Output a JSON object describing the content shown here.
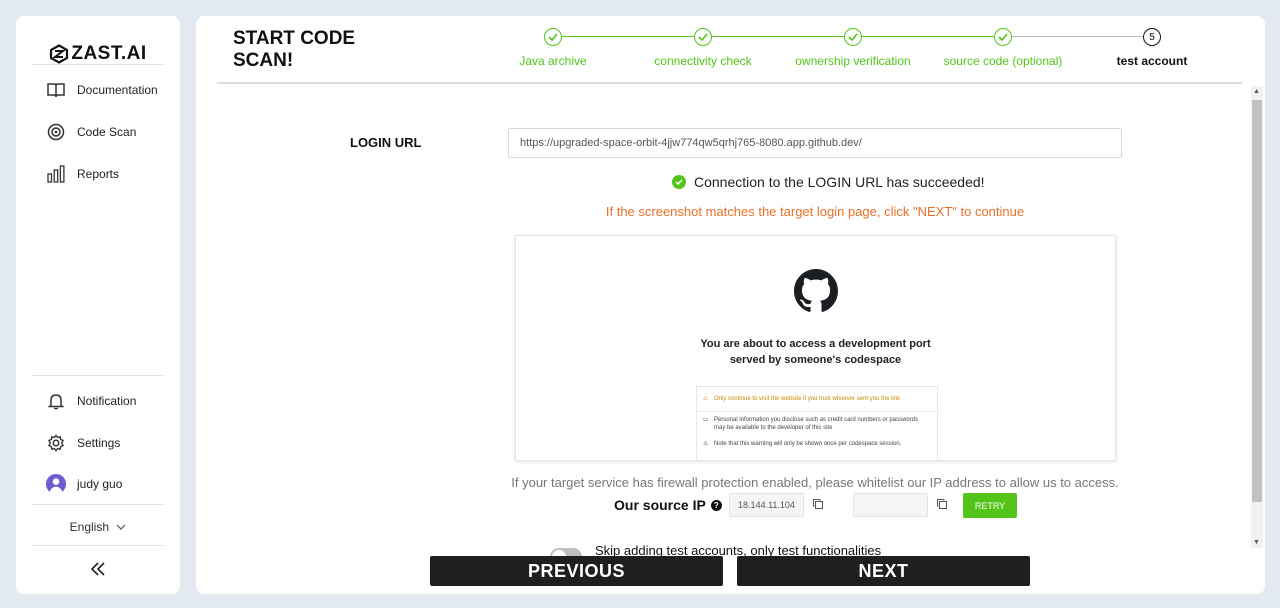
{
  "brand": {
    "name": "ZAST.AI"
  },
  "sidebar": {
    "items": [
      {
        "label": "Documentation",
        "icon": "book-icon"
      },
      {
        "label": "Code Scan",
        "icon": "scan-icon"
      },
      {
        "label": "Reports",
        "icon": "bar-chart-icon"
      }
    ],
    "bottom_items": [
      {
        "label": "Notification",
        "icon": "bell-icon"
      },
      {
        "label": "Settings",
        "icon": "gear-icon"
      },
      {
        "label": "judy guo",
        "icon": "avatar"
      }
    ],
    "language": "English"
  },
  "header": {
    "title": "START CODE SCAN!",
    "steps": [
      {
        "label": "Java archive",
        "status": "done"
      },
      {
        "label": "connectivity check",
        "status": "done"
      },
      {
        "label": "ownership verification",
        "status": "done"
      },
      {
        "label": "source code (optional)",
        "status": "done"
      },
      {
        "label": "test account",
        "status": "current",
        "number": "5"
      }
    ]
  },
  "form": {
    "login_label": "LOGIN URL",
    "login_url": "https://upgraded-space-orbit-4jjw774qw5qrhj765-8080.app.github.dev/",
    "success_message": "Connection to the LOGIN URL has succeeded!",
    "hint": "If the screenshot matches the target login page, click \"NEXT\" to continue"
  },
  "screenshot": {
    "heading_line1": "You are about to access a development port",
    "heading_line2": "served by someone's codespace",
    "notice_warning": "Only continue to visit the website if you trust whoever sent you the link",
    "notice_info": "Personal information you disclose such as credit card numbers or passwords may be available to the developer of this site",
    "notice_note": "Note that this warning will only be shown once per codespace session."
  },
  "firewall": {
    "message": "If your target service has firewall protection enabled, please whitelist our IP address to allow us to access.",
    "ip_label": "Our source IP",
    "ip_primary": "18.144.11.104",
    "ip_secondary": "",
    "retry_label": "RETRY"
  },
  "skip": {
    "label": "Skip adding test accounts, only test functionalities",
    "enabled": false
  },
  "buttons": {
    "previous": "PREVIOUS",
    "next": "NEXT"
  },
  "colors": {
    "accent_green": "#52c41a",
    "hint_orange": "#e8702a",
    "dark_button": "#1f1f1f"
  }
}
